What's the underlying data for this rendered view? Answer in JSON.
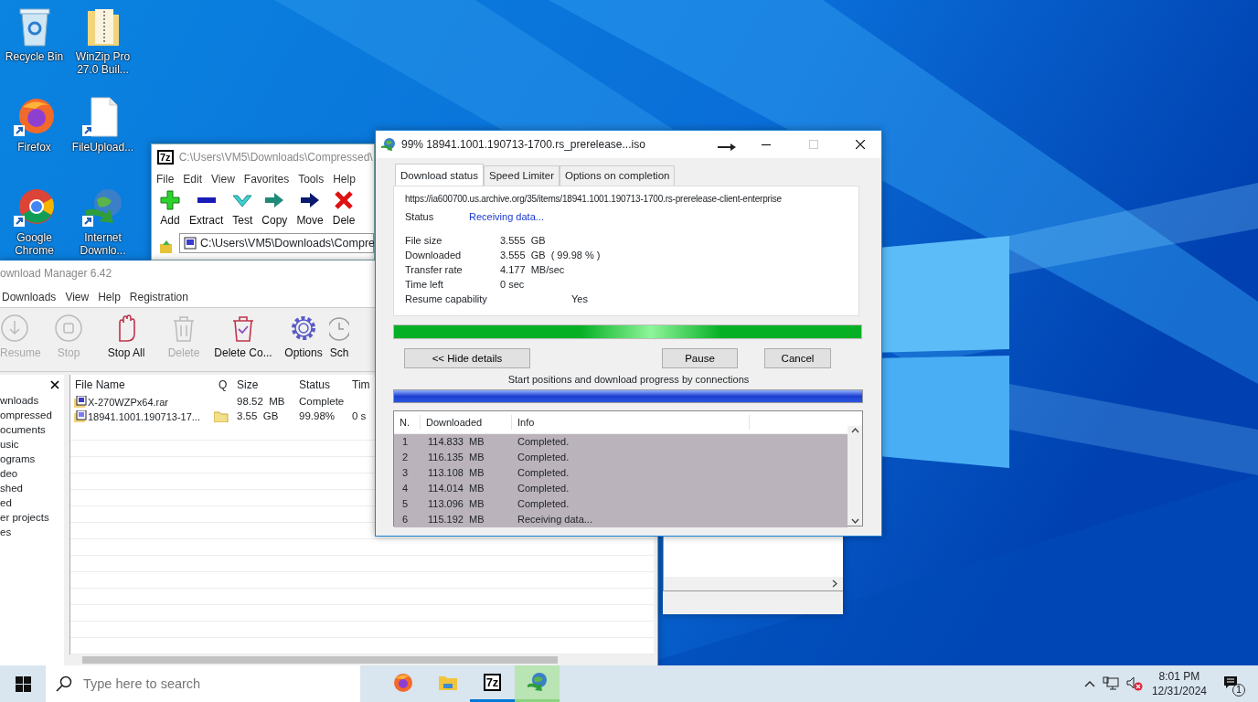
{
  "desktop_icons": [
    {
      "label": "Recycle Bin",
      "kind": "recycle"
    },
    {
      "label": "WinZip Pro 27.0 Buil...",
      "kind": "zipfolder"
    },
    {
      "label": "Firefox",
      "kind": "firefox"
    },
    {
      "label": "FileUpload...",
      "kind": "file"
    },
    {
      "label": "Google Chrome",
      "kind": "chrome"
    },
    {
      "label": "Internet Downlo...",
      "kind": "idm"
    }
  ],
  "zip_window": {
    "logo": "7z",
    "title": "C:\\Users\\VM5\\Downloads\\Compressed\\",
    "menu": [
      "File",
      "Edit",
      "View",
      "Favorites",
      "Tools",
      "Help"
    ],
    "toolbar": [
      {
        "label": "Add",
        "kind": "add"
      },
      {
        "label": "Extract",
        "kind": "extract"
      },
      {
        "label": "Test",
        "kind": "test"
      },
      {
        "label": "Copy",
        "kind": "copy"
      },
      {
        "label": "Move",
        "kind": "move"
      },
      {
        "label": "Dele",
        "kind": "delete"
      }
    ],
    "address": "C:\\Users\\VM5\\Downloads\\Compre"
  },
  "idm_window": {
    "title": "ownload Manager 6.42",
    "menu": [
      "Downloads",
      "View",
      "Help",
      "Registration"
    ],
    "toolbar": [
      {
        "label": "Resume",
        "kind": "resume",
        "disabled": true
      },
      {
        "label": "Stop",
        "kind": "stop",
        "disabled": true
      },
      {
        "label": "Stop All",
        "kind": "stopall",
        "disabled": false
      },
      {
        "label": "Delete",
        "kind": "delete",
        "disabled": true
      },
      {
        "label": "Delete Co...",
        "kind": "deletecompleted",
        "disabled": false
      },
      {
        "label": "Options",
        "kind": "options",
        "disabled": false
      },
      {
        "label": "Sch",
        "kind": "schedule",
        "disabled": false
      }
    ],
    "categories": [
      "wnloads",
      "ompressed",
      "ocuments",
      "usic",
      "ograms",
      "deo",
      "shed",
      "ed",
      "er projects",
      "es"
    ],
    "columns": [
      "File Name",
      "Q",
      "Size",
      "Status",
      "Tim"
    ],
    "rows": [
      {
        "kind": "rar",
        "file_name": "X-270WZPx64.rar",
        "in_queue": false,
        "size": "98.52  MB",
        "status": "Complete"
      },
      {
        "kind": "iso",
        "file_name": "18941.1001.190713-17...",
        "in_queue": true,
        "size": "3.55  GB",
        "status": "99.98%",
        "time": "0 s"
      }
    ]
  },
  "dialog": {
    "title": "99% 18941.1001.190713-1700.rs_prerelease...iso",
    "tabs": [
      {
        "label": "Download status",
        "selected": true
      },
      {
        "label": "Speed Limiter",
        "selected": false
      },
      {
        "label": "Options on completion",
        "selected": false
      }
    ],
    "url": "https://ia600700.us.archive.org/35/items/18941.1001.190713-1700.rs-prerelease-client-enterprise",
    "status_label": "Status",
    "status": "Receiving data...",
    "fields": [
      {
        "label": "File size",
        "value": "3.555  GB",
        "kind": "plain"
      },
      {
        "label": "Downloaded",
        "value": "3.555  GB  ( 99.98 % )",
        "kind": "plain"
      },
      {
        "label": "Transfer rate",
        "value": "4.177  MB/sec",
        "kind": "plain"
      },
      {
        "label": "Time left",
        "value": "0 sec",
        "kind": "plain"
      },
      {
        "label": "Resume capability",
        "value": "Yes",
        "kind": "flag"
      }
    ],
    "progress": {
      "level": 0.9998
    },
    "buttons": [
      "<< Hide details",
      "Pause",
      "Cancel"
    ],
    "connections_caption": "Start positions and download progress by connections",
    "connections_columns": [
      "N.",
      "Downloaded",
      "Info"
    ],
    "connections": [
      {
        "n": "1",
        "downloaded": "114.833  MB",
        "info": "Completed."
      },
      {
        "n": "2",
        "downloaded": "116.135  MB",
        "info": "Completed."
      },
      {
        "n": "3",
        "downloaded": "113.108  MB",
        "info": "Completed."
      },
      {
        "n": "4",
        "downloaded": "114.014  MB",
        "info": "Completed."
      },
      {
        "n": "5",
        "downloaded": "113.096  MB",
        "info": "Completed."
      },
      {
        "n": "6",
        "downloaded": "115.192  MB",
        "info": "Receiving data..."
      }
    ]
  },
  "taskbar": {
    "search_placeholder": "Type here to search",
    "apps": [
      {
        "kind": "firefox",
        "running": false,
        "selected": false
      },
      {
        "kind": "explorer",
        "running": false,
        "selected": false
      },
      {
        "kind": "sevenzip",
        "label": "7z",
        "running": true,
        "selected": false
      },
      {
        "kind": "idm",
        "running": true,
        "selected": true
      }
    ],
    "time": "8:01 PM",
    "date": "12/31/2024",
    "notifications": "1"
  }
}
